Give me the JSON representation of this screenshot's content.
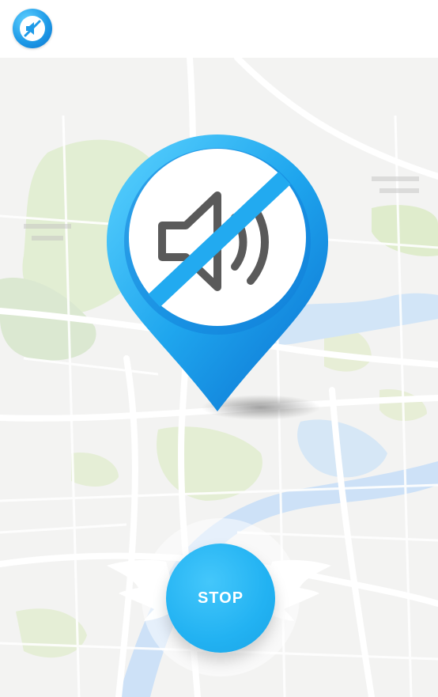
{
  "header": {
    "app_icon": "mute-pin-icon"
  },
  "map": {
    "background": "street-map"
  },
  "pin": {
    "icon": "speaker-muted-icon",
    "accent": "#1e9be8"
  },
  "stop_button": {
    "label": "STOP",
    "color": "#22b2f2"
  },
  "colors": {
    "accent": "#1e9be8",
    "map_green": "#cfe3b3",
    "map_water": "#bcd9f6",
    "map_bg": "#eeeeee"
  }
}
